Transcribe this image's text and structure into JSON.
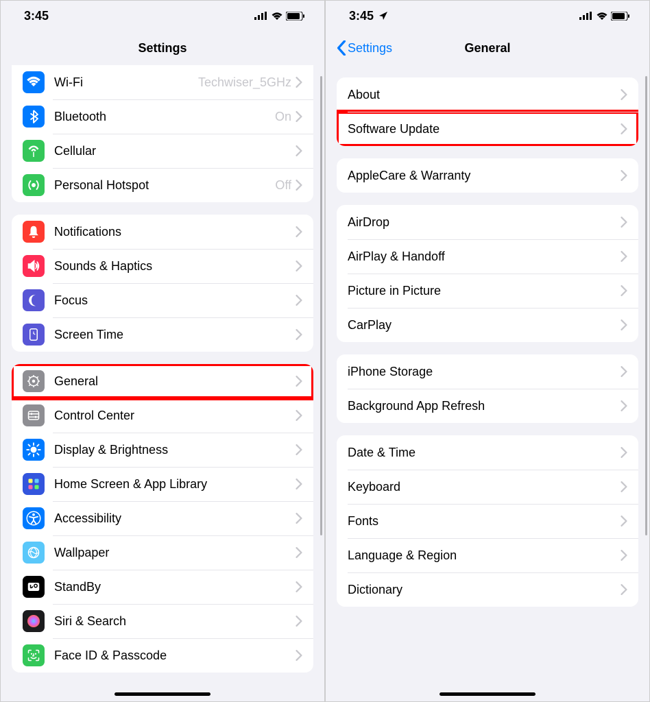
{
  "status": {
    "time": "3:45",
    "location_arrow": true
  },
  "left": {
    "title": "Settings",
    "groups": [
      {
        "rows": [
          {
            "icon": "wifi",
            "bg": "#007aff",
            "label": "Wi-Fi",
            "value": "Techwiser_5GHz"
          },
          {
            "icon": "bluetooth",
            "bg": "#007aff",
            "label": "Bluetooth",
            "value": "On"
          },
          {
            "icon": "cellular",
            "bg": "#34c759",
            "label": "Cellular",
            "value": ""
          },
          {
            "icon": "hotspot",
            "bg": "#34c759",
            "label": "Personal Hotspot",
            "value": "Off"
          }
        ]
      },
      {
        "rows": [
          {
            "icon": "notifications",
            "bg": "#ff3b30",
            "label": "Notifications",
            "value": ""
          },
          {
            "icon": "sounds",
            "bg": "#ff2d55",
            "label": "Sounds & Haptics",
            "value": ""
          },
          {
            "icon": "focus",
            "bg": "#5856d6",
            "label": "Focus",
            "value": ""
          },
          {
            "icon": "screentime",
            "bg": "#5856d6",
            "label": "Screen Time",
            "value": ""
          }
        ]
      },
      {
        "rows": [
          {
            "icon": "general",
            "bg": "#8e8e93",
            "label": "General",
            "value": "",
            "highlight": true
          },
          {
            "icon": "controlcenter",
            "bg": "#8e8e93",
            "label": "Control Center",
            "value": ""
          },
          {
            "icon": "display",
            "bg": "#007aff",
            "label": "Display & Brightness",
            "value": ""
          },
          {
            "icon": "homescreen",
            "bg": "#3355dd",
            "label": "Home Screen & App Library",
            "value": ""
          },
          {
            "icon": "accessibility",
            "bg": "#007aff",
            "label": "Accessibility",
            "value": ""
          },
          {
            "icon": "wallpaper",
            "bg": "#5ac8fa",
            "label": "Wallpaper",
            "value": ""
          },
          {
            "icon": "standby",
            "bg": "#000000",
            "label": "StandBy",
            "value": ""
          },
          {
            "icon": "siri",
            "bg": "#1c1c1e",
            "label": "Siri & Search",
            "value": ""
          },
          {
            "icon": "faceid",
            "bg": "#34c759",
            "label": "Face ID & Passcode",
            "value": ""
          }
        ]
      }
    ]
  },
  "right": {
    "back": "Settings",
    "title": "General",
    "groups": [
      {
        "rows": [
          {
            "label": "About"
          },
          {
            "label": "Software Update",
            "highlight": true
          }
        ]
      },
      {
        "rows": [
          {
            "label": "AppleCare & Warranty"
          }
        ]
      },
      {
        "rows": [
          {
            "label": "AirDrop"
          },
          {
            "label": "AirPlay & Handoff"
          },
          {
            "label": "Picture in Picture"
          },
          {
            "label": "CarPlay"
          }
        ]
      },
      {
        "rows": [
          {
            "label": "iPhone Storage"
          },
          {
            "label": "Background App Refresh"
          }
        ]
      },
      {
        "rows": [
          {
            "label": "Date & Time"
          },
          {
            "label": "Keyboard"
          },
          {
            "label": "Fonts"
          },
          {
            "label": "Language & Region"
          },
          {
            "label": "Dictionary"
          }
        ]
      }
    ]
  }
}
